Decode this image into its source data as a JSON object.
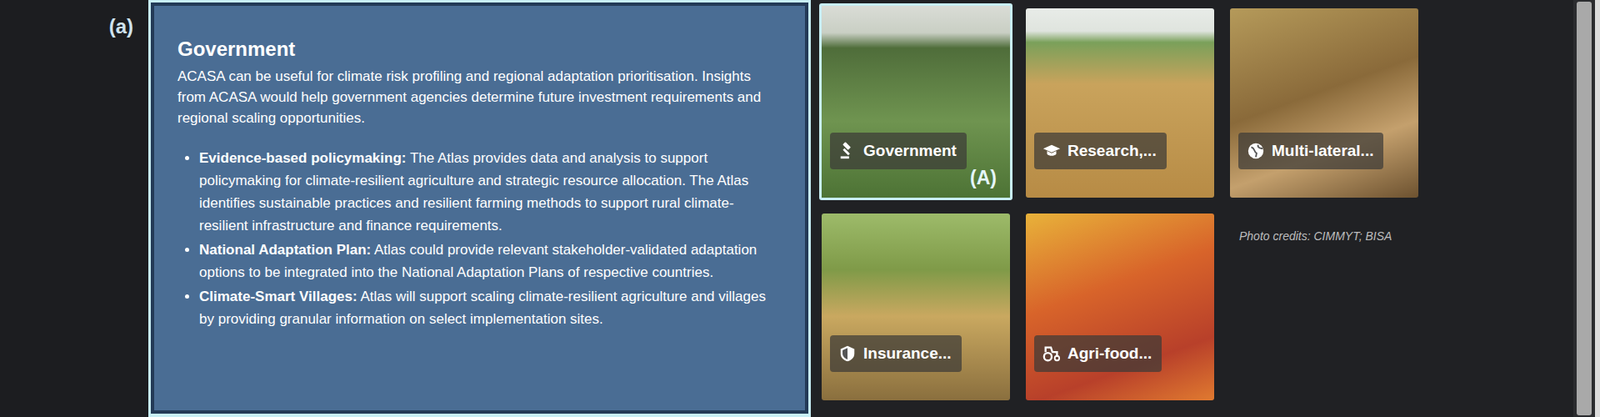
{
  "figure_label": "(a)",
  "panel": {
    "title": "Government",
    "intro": "ACASA can be useful for climate risk profiling and regional adaptation prioritisation. Insights from ACASA would help government agencies determine future investment requirements and regional scaling opportunities.",
    "bullets": [
      {
        "lead": "Evidence-based policymaking:",
        "text": "The Atlas provides data and analysis to support policymaking for climate-resilient agriculture and strategic resource allocation. The Atlas identifies sustainable practices and resilient farming methods to support rural climate-resilient infrastructure and finance requirements."
      },
      {
        "lead": "National Adaptation Plan:",
        "text": "Atlas could provide relevant stakeholder-validated adaptation options to be integrated into the National Adaptation Plans of respective countries."
      },
      {
        "lead": "Climate-Smart Villages:",
        "text": "Atlas will support scaling climate-resilient agriculture and villages by providing granular information on select implementation sites."
      }
    ]
  },
  "cards": [
    {
      "label": "Government",
      "selected": true,
      "marker": "(A)"
    },
    {
      "label": "Research,...",
      "selected": false,
      "marker": ""
    },
    {
      "label": "Multi-lateral...",
      "selected": false,
      "marker": ""
    },
    {
      "label": "Insurance...",
      "selected": false,
      "marker": ""
    },
    {
      "label": "Agri-food...",
      "selected": false,
      "marker": ""
    }
  ],
  "photo_credits": "Photo credits: CIMMYT; BISA"
}
